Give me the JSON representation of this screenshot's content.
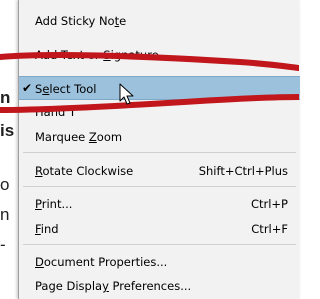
{
  "background_fragments": [
    {
      "text": "n",
      "bold": true
    },
    {
      "text": "is",
      "bold": true
    },
    {
      "text": "o",
      "bold": false
    },
    {
      "text": "n",
      "bold": false
    },
    {
      "text": "-",
      "bold": false
    }
  ],
  "menu": {
    "items": [
      {
        "pre": "Add Sticky No",
        "mn": "t",
        "post": "e",
        "shortcut": "",
        "checked": false,
        "selected": false
      },
      {
        "pre": "Add Text or ",
        "mn": "S",
        "post": "ignature",
        "shortcut": "",
        "checked": false,
        "selected": false
      },
      {
        "pre": "S",
        "mn": "e",
        "post": "lect Tool",
        "shortcut": "",
        "checked": true,
        "selected": true
      },
      {
        "pre": "Hand T",
        "mn": "",
        "post": "",
        "shortcut": "",
        "checked": false,
        "selected": false
      },
      {
        "pre": "Marquee ",
        "mn": "Z",
        "post": "oom",
        "shortcut": "",
        "checked": false,
        "selected": false
      },
      {
        "pre": "",
        "mn": "R",
        "post": "otate Clockwise",
        "shortcut": "Shift+Ctrl+Plus",
        "checked": false,
        "selected": false
      },
      {
        "pre": "",
        "mn": "P",
        "post": "rint...",
        "shortcut": "Ctrl+P",
        "checked": false,
        "selected": false
      },
      {
        "pre": "",
        "mn": "F",
        "post": "ind",
        "shortcut": "Ctrl+F",
        "checked": false,
        "selected": false
      },
      {
        "pre": "",
        "mn": "D",
        "post": "ocument Properties...",
        "shortcut": "",
        "checked": false,
        "selected": false
      },
      {
        "pre": "Page Displa",
        "mn": "y",
        "post": " Preferences...",
        "shortcut": "",
        "checked": false,
        "selected": false
      }
    ],
    "check_glyph": "✔"
  },
  "colors": {
    "selected_bg": "#9cc1dc",
    "menu_bg": "#f2f2f2",
    "annotation_stroke": "#c0161c"
  }
}
